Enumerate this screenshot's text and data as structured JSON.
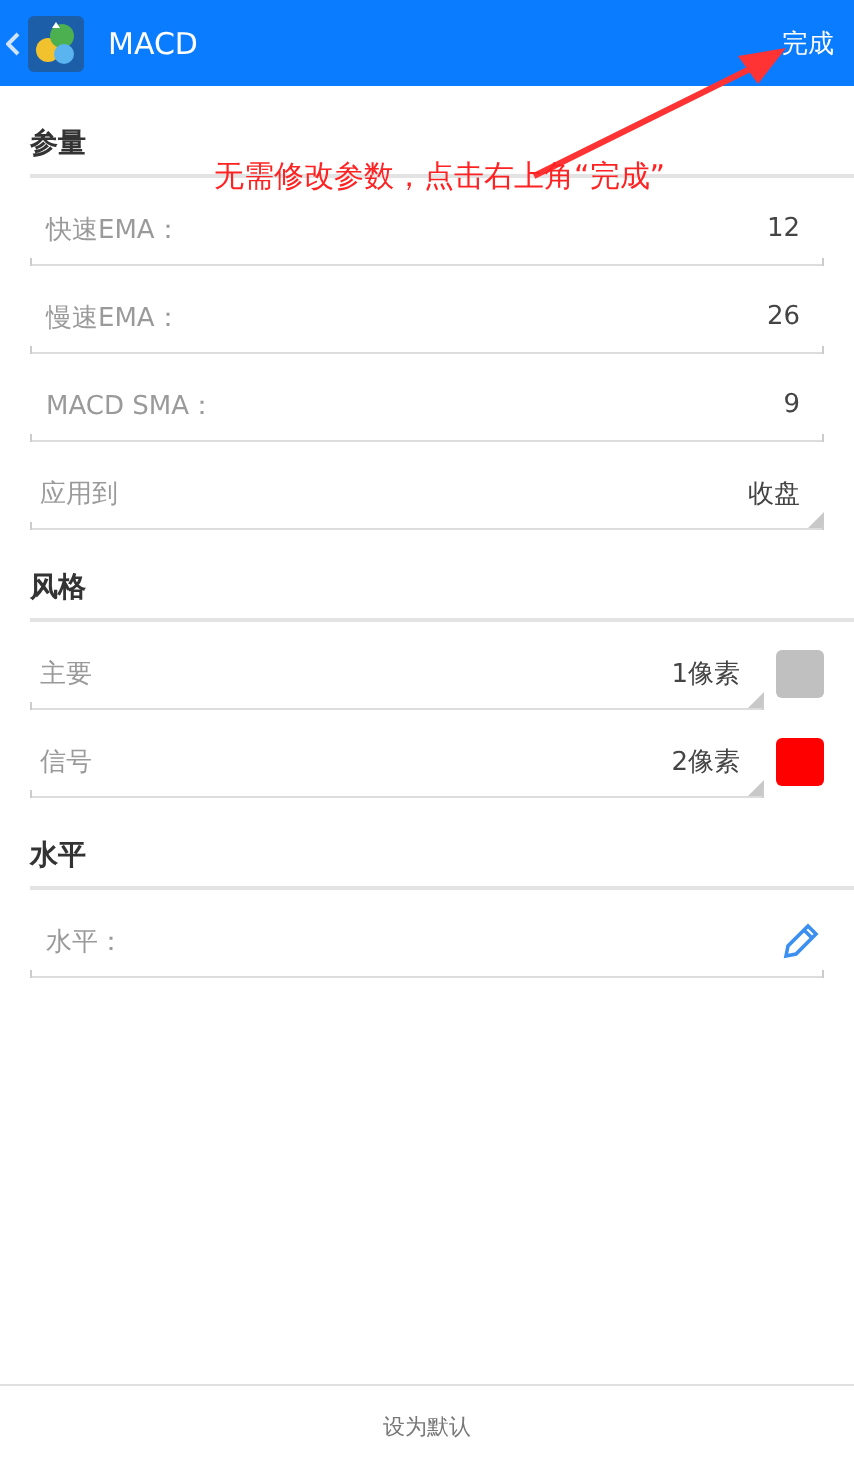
{
  "header": {
    "title": "MACD",
    "done": "完成"
  },
  "annotation": {
    "text": "无需修改参数，点击右上角“完成”"
  },
  "sections": [
    {
      "title": "参量",
      "rows": [
        {
          "kind": "input",
          "label": "快速EMA：",
          "value": "12"
        },
        {
          "kind": "input",
          "label": "慢速EMA：",
          "value": "26"
        },
        {
          "kind": "input",
          "label": "MACD SMA：",
          "value": "9"
        },
        {
          "kind": "select",
          "label": "应用到",
          "value": "收盘"
        }
      ]
    },
    {
      "title": "风格",
      "rows": [
        {
          "kind": "style",
          "label": "主要",
          "value": "1像素",
          "color": "#c0c0c0"
        },
        {
          "kind": "style",
          "label": "信号",
          "value": "2像素",
          "color": "#ff0000"
        }
      ]
    },
    {
      "title": "水平",
      "rows": [
        {
          "kind": "edit",
          "label": "水平："
        }
      ]
    }
  ],
  "footer": {
    "button": "设为默认"
  }
}
